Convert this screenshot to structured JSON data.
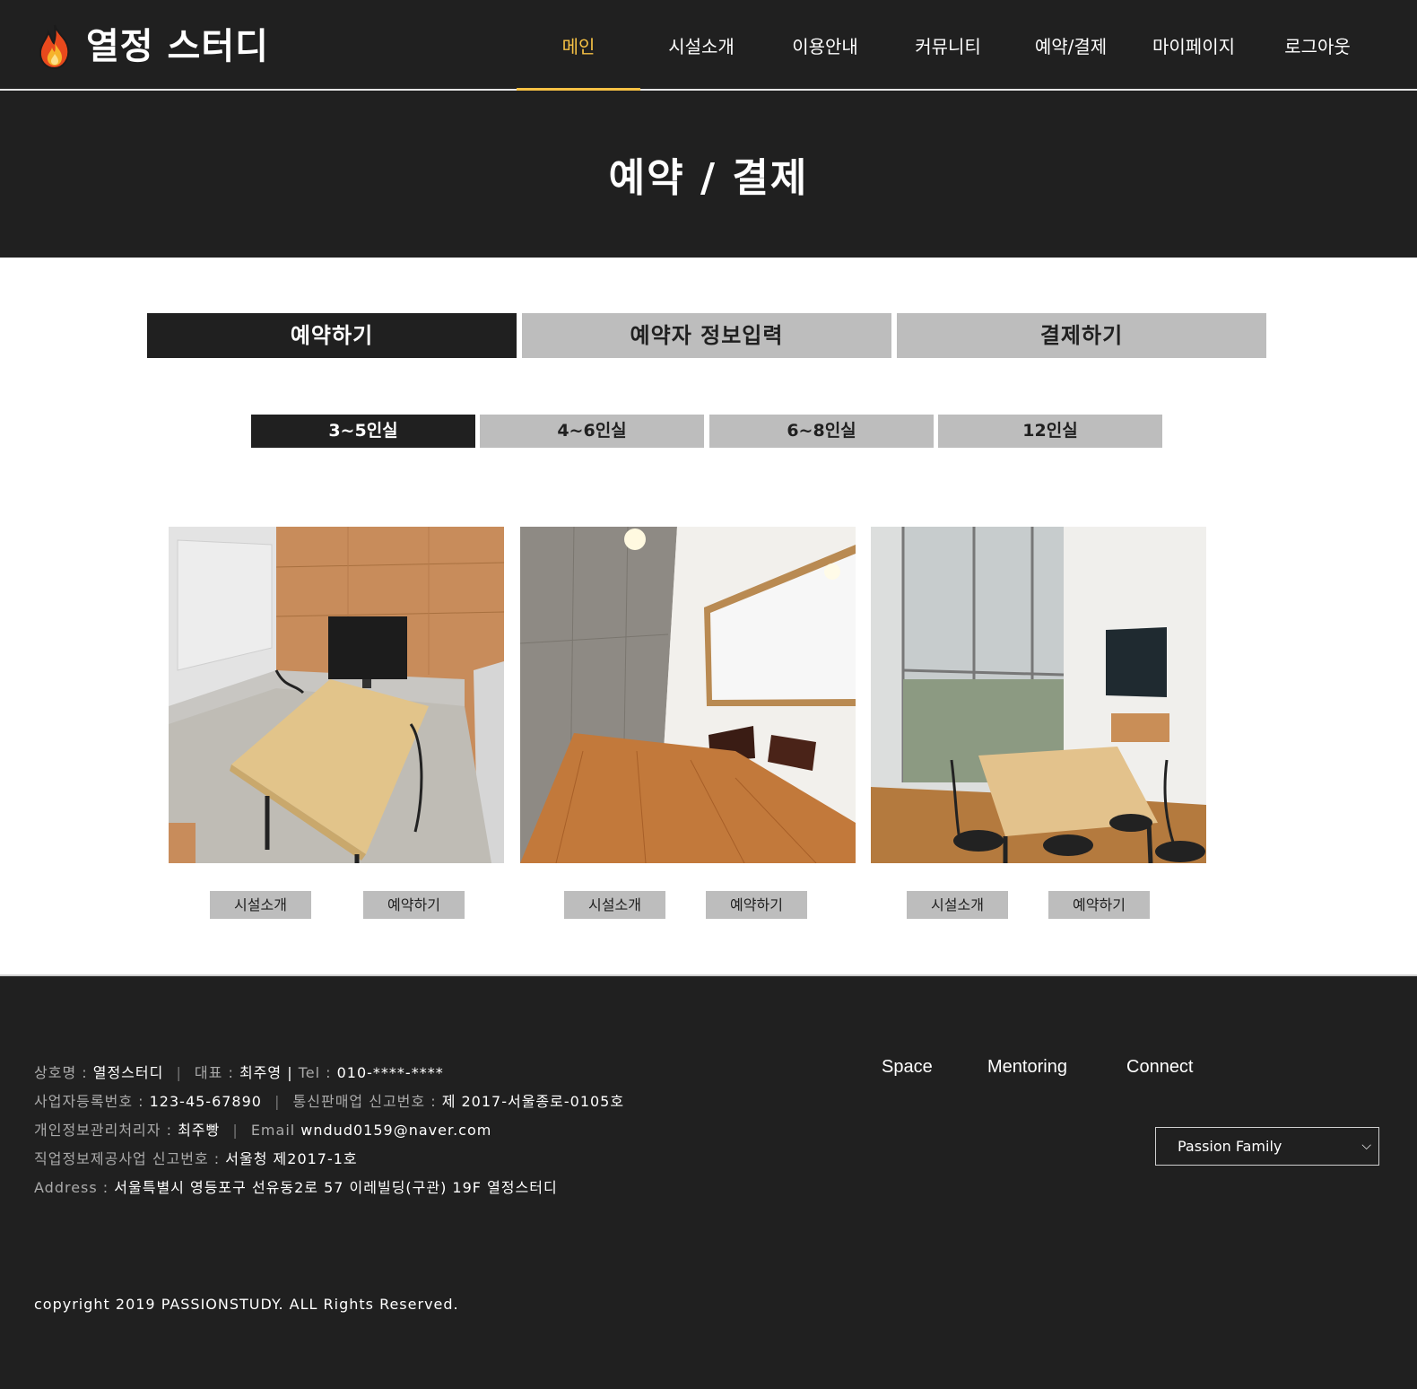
{
  "header": {
    "logo_text": "열정 스터디",
    "nav": [
      "메인",
      "시설소개",
      "이용안내",
      "커뮤니티",
      "예약/결제",
      "마이페이지",
      "로그아웃"
    ]
  },
  "banner": {
    "title": "예약 / 결제"
  },
  "steps": [
    "예약하기",
    "예약자 정보입력",
    "결제하기"
  ],
  "room_tabs": [
    "3~5인실",
    "4~6인실",
    "6~8인실",
    "12인실"
  ],
  "rooms": [
    {
      "intro_label": "시설소개",
      "reserve_label": "예약하기"
    },
    {
      "intro_label": "시설소개",
      "reserve_label": "예약하기"
    },
    {
      "intro_label": "시설소개",
      "reserve_label": "예약하기"
    }
  ],
  "footer": {
    "company_label": "상호명 :",
    "company": "열정스터디",
    "ceo_label": "대표 :",
    "ceo": "최주영",
    "tel_label": "Tel :",
    "tel": "010-****-****",
    "bizno_label": "사업자등록번호 :",
    "bizno": "123-45-67890",
    "mailorder_label": "통신판매업 신고번호 :",
    "mailorder": "제 2017-서울종로-0105호",
    "privacy_label": "개인정보관리처리자 :",
    "privacy": "최주빵",
    "email_label": "Email",
    "email": "wndud0159@naver.com",
    "jobinfo_label": "직업정보제공사업 신고번호 :",
    "jobinfo": "서울청 제2017-1호",
    "address_label": "Address :",
    "address": "서울특별시 영등포구 선유동2로 57 이레빌딩(구관) 19F 열정스터디",
    "links": [
      "Space",
      "Mentoring",
      "Connect"
    ],
    "select_value": "Passion Family",
    "copyright": "copyright 2019 PASSIONSTUDY. ALL Rights Reserved."
  },
  "colors": {
    "dark": "#202020",
    "accent": "#f6c144",
    "tab_inactive": "#bdbdbd"
  }
}
